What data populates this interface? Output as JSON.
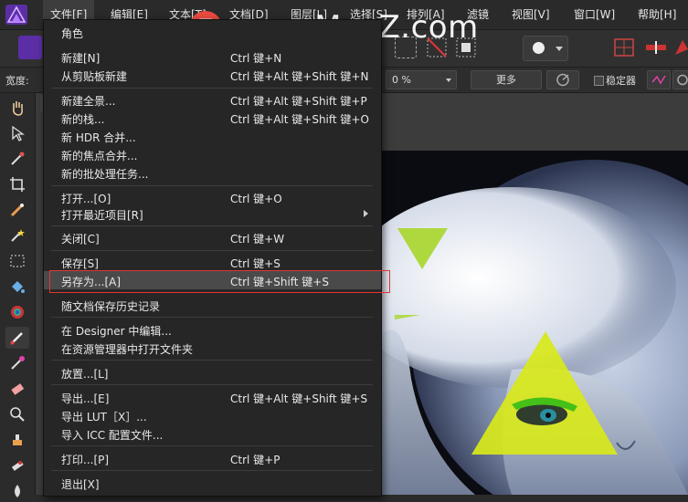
{
  "menubar": {
    "items": [
      "文件[F]",
      "编辑[E]",
      "文本[T]",
      "文档[D]",
      "图层[L]",
      "选择[S]",
      "排列[A]",
      "滤镜",
      "视图[V]",
      "窗口[W]",
      "帮助[H]"
    ]
  },
  "contextbar": {
    "width_label": "宽度:",
    "percent_value": "0 %",
    "more_button": "更多",
    "stabilizer_label": "稳定器"
  },
  "file_menu": {
    "items": [
      {
        "label": "角色",
        "shortcut": ""
      },
      {
        "label": "新建[N]",
        "shortcut": "Ctrl 键+N"
      },
      {
        "label": "从剪贴板新建",
        "shortcut": "Ctrl 键+Alt 键+Shift 键+N"
      },
      {
        "label": "新建全景...",
        "shortcut": "Ctrl 键+Alt 键+Shift 键+P"
      },
      {
        "label": "新的栈...",
        "shortcut": "Ctrl 键+Alt 键+Shift 键+O"
      },
      {
        "label": "新 HDR 合并...",
        "shortcut": ""
      },
      {
        "label": "新的焦点合并...",
        "shortcut": ""
      },
      {
        "label": "新的批处理任务...",
        "shortcut": ""
      },
      {
        "label": "打开...[O]",
        "shortcut": "Ctrl 键+O"
      },
      {
        "label": "打开最近项目[R]",
        "shortcut": ""
      },
      {
        "label": "关闭[C]",
        "shortcut": "Ctrl 键+W"
      },
      {
        "label": "保存[S]",
        "shortcut": "Ctrl 键+S"
      },
      {
        "label": "另存为...[A]",
        "shortcut": "Ctrl 键+Shift 键+S"
      },
      {
        "label": "随文档保存历史记录",
        "shortcut": ""
      },
      {
        "label": "在 Designer 中编辑...",
        "shortcut": ""
      },
      {
        "label": "在资源管理器中打开文件夹",
        "shortcut": ""
      },
      {
        "label": "放置...[L]",
        "shortcut": ""
      },
      {
        "label": "导出...[E]",
        "shortcut": "Ctrl 键+Alt 键+Shift 键+S"
      },
      {
        "label": "导出 LUT［X］...",
        "shortcut": ""
      },
      {
        "label": "导入 ICC 配置文件...",
        "shortcut": ""
      },
      {
        "label": "打印...[P]",
        "shortcut": "Ctrl 键+P"
      },
      {
        "label": "退出[X]",
        "shortcut": ""
      }
    ]
  },
  "watermark": {
    "logo_letter": "Z",
    "text": "www.MacZ.com"
  },
  "colors": {
    "highlight_box": "#e23535",
    "accent_yellow": "#d8e81a",
    "app_logo": "#7a3fc4"
  }
}
